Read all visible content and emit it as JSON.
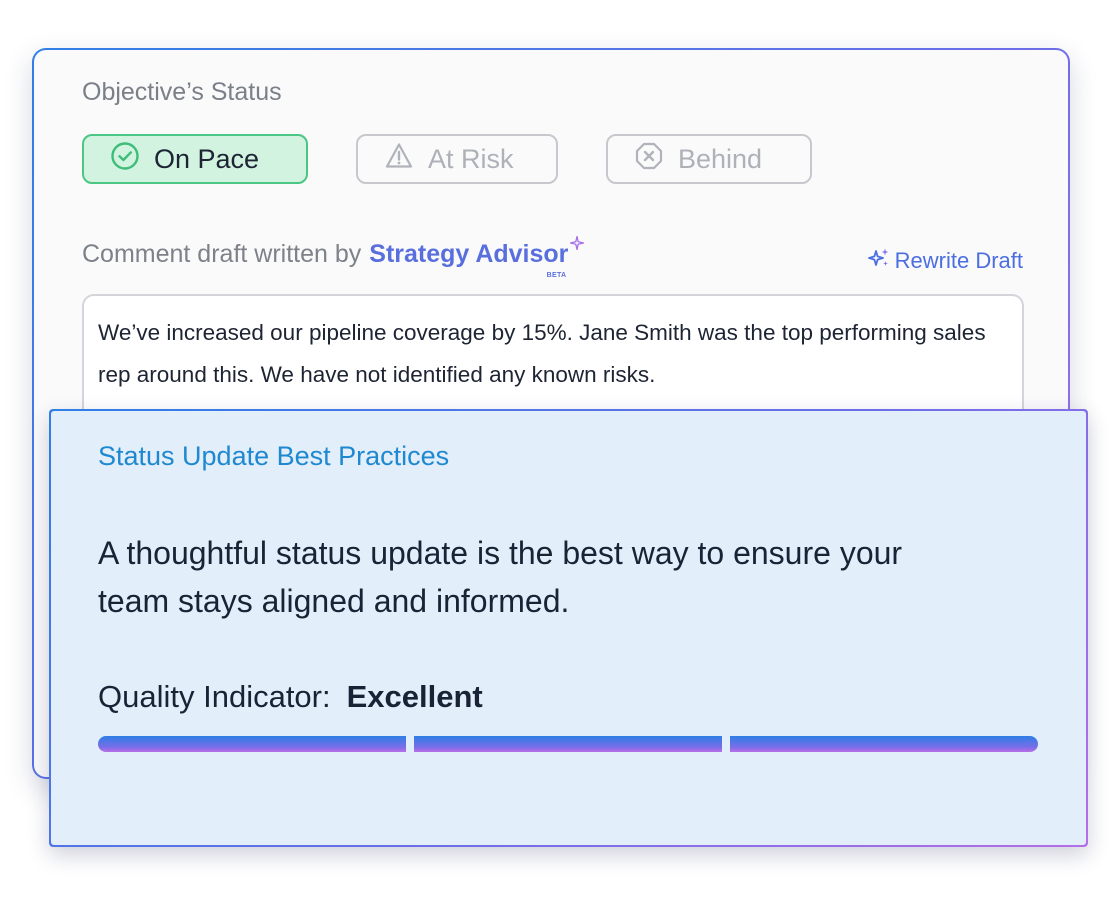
{
  "objective_status": {
    "heading": "Objective’s Status",
    "options": [
      {
        "label": "On Pace",
        "icon": "check-circle-icon",
        "selected": true
      },
      {
        "label": "At Risk",
        "icon": "warning-triangle-icon",
        "selected": false
      },
      {
        "label": "Behind",
        "icon": "x-octagon-icon",
        "selected": false
      }
    ]
  },
  "comment": {
    "prefix": "Comment draft written by",
    "advisor_name": "Strategy Advisor",
    "advisor_badge": "BETA",
    "rewrite_label": "Rewrite Draft",
    "draft_text": "We’ve increased our pipeline coverage by 15%. Jane Smith was the top performing sales rep around this. We have not identified any known risks."
  },
  "best_practices": {
    "title": "Status Update Best Practices",
    "message": "A thoughtful status update is the best way to ensure your team stays aligned and informed.",
    "quality_label": "Quality Indicator:",
    "quality_value": "Excellent",
    "quality_filled_segments": 3,
    "quality_total_segments": 3
  },
  "colors": {
    "accent_blue": "#1e88d0",
    "on_pace_green": "#4cc684",
    "on_pace_bg": "#d3f3e1",
    "gradient_start": "#2f7ee6",
    "gradient_end": "#b56ee8",
    "panel_bg": "#e2eef9"
  }
}
